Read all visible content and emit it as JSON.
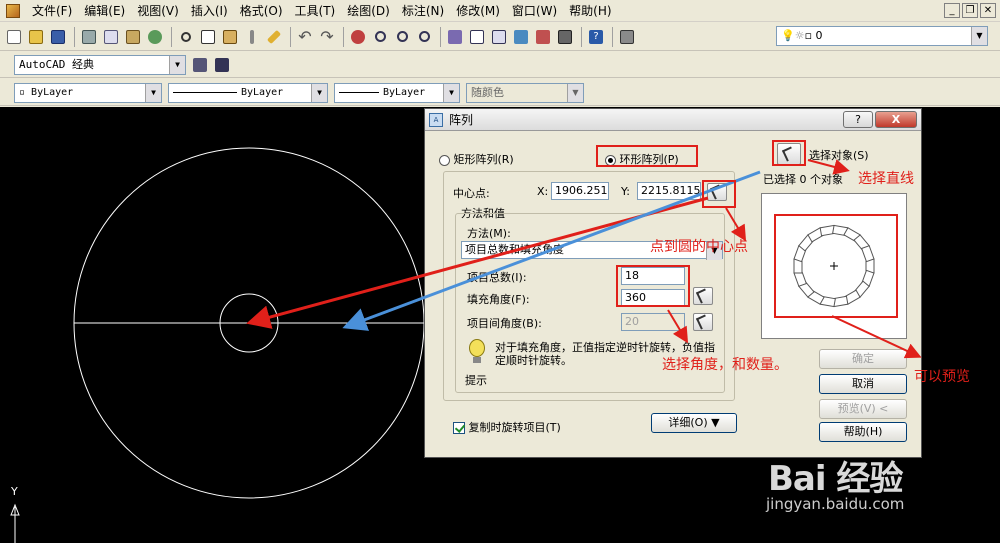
{
  "menu": {
    "items": [
      "文件(F)",
      "编辑(E)",
      "视图(V)",
      "插入(I)",
      "格式(O)",
      "工具(T)",
      "绘图(D)",
      "标注(N)",
      "修改(M)",
      "窗口(W)",
      "帮助(H)"
    ]
  },
  "toolbar": {
    "layer_value": "0",
    "workspace": "AutoCAD 经典",
    "color_value": "ByLayer",
    "linetype_value": "ByLayer",
    "lineweight_value": "ByLayer",
    "plotstyle_value": "随颜色"
  },
  "canvas": {
    "ucs_y_label": "Y"
  },
  "dialog": {
    "title": "阵列",
    "help_glyph": "?",
    "close_glyph": "X",
    "rect_array_label": "矩形阵列(R)",
    "polar_array_label": "环形阵列(P)",
    "select_objects_label": "选择对象(S)",
    "selected_count_text": "已选择 0 个对象",
    "center_point_label": "中心点:",
    "x_label": "X:",
    "x_value": "1906.251",
    "y_label": "Y:",
    "y_value": "2215.8115",
    "method_group_label": "方法和值",
    "method_label": "方法(M):",
    "method_value": "项目总数和填充角度",
    "total_items_label": "项目总数(I):",
    "total_items_value": "18",
    "fill_angle_label": "填充角度(F):",
    "fill_angle_value": "360",
    "angle_between_label": "项目间角度(B):",
    "angle_between_value": "20",
    "tip_text": "对于填充角度，正值指定逆时针旋转，负值指定顺时针旋转。",
    "tip_label": "提示",
    "rotate_copy_label": "复制时旋转项目(T)",
    "details_label": "详细(O)",
    "ok_label": "确定",
    "cancel_label": "取消",
    "preview_label": "预览(V) <",
    "help_label": "帮助(H)"
  },
  "annotations": {
    "select_line": "选择直线",
    "click_center": "点到圆的中心点",
    "select_angle_count": "选择角度，和数量。",
    "can_preview": "可以预览"
  },
  "watermark": {
    "brand": "Bai 经验",
    "url": "jingyan.baidu.com"
  },
  "colors": {
    "annotation_red": "#e0201a",
    "annotation_blue": "#4a90d9",
    "canvas_bg": "#000000",
    "drawing_white": "#ffffff"
  },
  "icons": [
    "app-icon",
    "new-icon",
    "open-icon",
    "save-icon",
    "print-icon",
    "preview-icon",
    "publish-icon",
    "cut-icon",
    "copy-icon",
    "paste-icon",
    "match-icon",
    "undo-icon",
    "redo-icon",
    "pan-icon",
    "zoom-icon",
    "properties-icon",
    "design-center-icon",
    "tool-palette-icon",
    "calculator-icon",
    "help-icon",
    "layer-icon"
  ]
}
